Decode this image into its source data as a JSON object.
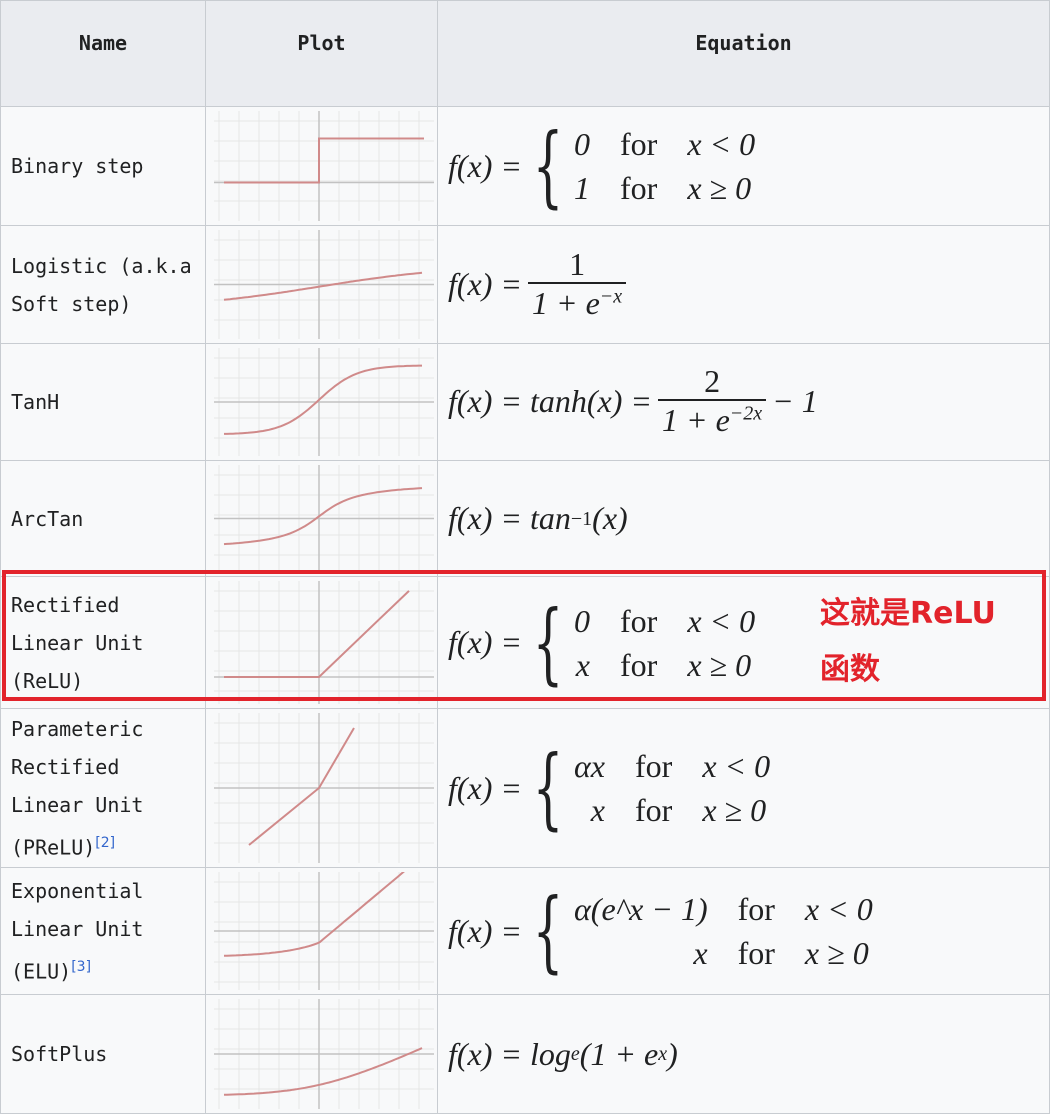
{
  "headers": {
    "name": "Name",
    "plot": "Plot",
    "equation": "Equation"
  },
  "rows": [
    {
      "name_lines": [
        "Binary step"
      ],
      "ref": "",
      "plot": {
        "curve": "binary-step"
      },
      "equation": {
        "lhs": "f(x) =",
        "cases": [
          [
            "0",
            "for",
            "x < 0"
          ],
          [
            "1",
            "for",
            "x ≥ 0"
          ]
        ]
      }
    },
    {
      "name_lines": [
        "Logistic (a.k.a",
        "Soft step)"
      ],
      "ref": "",
      "plot": {
        "curve": "logistic"
      },
      "equation": {
        "lhs": "f(x) =",
        "num": "1",
        "den_base": "1 + e",
        "den_sup": "−x"
      }
    },
    {
      "name_lines": [
        "TanH"
      ],
      "ref": "",
      "plot": {
        "curve": "tanh"
      },
      "equation": {
        "lhs": "f(x) = tanh(x) =",
        "num": "2",
        "den_base": "1 + e",
        "den_sup": "−2x",
        "tail": "− 1"
      }
    },
    {
      "name_lines": [
        "ArcTan"
      ],
      "ref": "",
      "plot": {
        "curve": "arctan"
      },
      "equation": {
        "lhs": "f(x) = tan",
        "sup": "−1",
        "tail": "(x)"
      }
    },
    {
      "name_lines": [
        "Rectified",
        "Linear Unit",
        "(ReLU)"
      ],
      "ref": "",
      "plot": {
        "curve": "relu"
      },
      "equation": {
        "lhs": "f(x) =",
        "cases": [
          [
            "0",
            "for",
            "x < 0"
          ],
          [
            "x",
            "for",
            "x ≥ 0"
          ]
        ]
      }
    },
    {
      "name_lines": [
        "Parameteric",
        "Rectified",
        "Linear Unit",
        "(PReLU)"
      ],
      "ref": "[2]",
      "plot": {
        "curve": "prelu"
      },
      "equation": {
        "lhs": "f(x) =",
        "cases": [
          [
            "αx",
            "for",
            "x < 0"
          ],
          [
            "x",
            "for",
            "x ≥ 0"
          ]
        ]
      }
    },
    {
      "name_lines": [
        "Exponential",
        "Linear Unit",
        "(ELU)"
      ],
      "ref": "[3]",
      "plot": {
        "curve": "elu"
      },
      "equation": {
        "lhs": "f(x) =",
        "cases": [
          [
            "α(e^x − 1)",
            "for",
            "x < 0"
          ],
          [
            "x",
            "for",
            "x ≥ 0"
          ]
        ]
      }
    },
    {
      "name_lines": [
        "SoftPlus"
      ],
      "ref": "",
      "plot": {
        "curve": "softplus"
      },
      "equation": {
        "lhs": "f(x) = log",
        "sub": "e",
        "tail": "(1 + e",
        "tail_sup": "x",
        "tail_end": ")"
      }
    }
  ],
  "annotation": {
    "line1": "这就是ReLU",
    "line2": "函数"
  },
  "colors": {
    "highlight": "#e2232b",
    "curve": "#d08a8a",
    "header_bg": "#eaecf0",
    "cell_bg": "#f8f9fa"
  }
}
